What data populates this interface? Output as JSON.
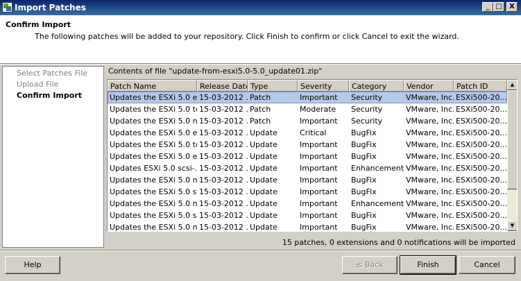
{
  "window": {
    "title": "Import Patches",
    "minimize_glyph": "_",
    "maximize_glyph": "□",
    "close_glyph": "X"
  },
  "header": {
    "title": "Confirm Import",
    "description": "The following patches will be added to your repository. Click Finish to confirm or click Cancel to exit the wizard."
  },
  "steps": [
    {
      "label": "Select Patches File",
      "state": "done"
    },
    {
      "label": "Upload File",
      "state": "done"
    },
    {
      "label": "Confirm Import",
      "state": "current"
    }
  ],
  "file_label": "Contents of file \"update-from-esxi5.0-5.0_update01.zip\"",
  "table": {
    "columns": [
      "Patch Name",
      "Release Date",
      "Type",
      "Severity",
      "Category",
      "Vendor",
      "Patch ID"
    ],
    "rows": [
      [
        "Updates the ESXi 5.0 e...",
        "15-03-2012 ...",
        "Patch",
        "Important",
        "Security",
        "VMware, Inc.",
        "ESXi500-20..."
      ],
      [
        "Updates the ESXi 5.0 to...",
        "15-03-2012 ...",
        "Patch",
        "Moderate",
        "Security",
        "VMware, Inc.",
        "ESXi500-20..."
      ],
      [
        "Updates the ESXi 5.0 n...",
        "15-03-2012 ...",
        "Patch",
        "Important",
        "Security",
        "VMware, Inc.",
        "ESXi500-20..."
      ],
      [
        "Updates the ESXi 5.0 e...",
        "15-03-2012 ...",
        "Update",
        "Critical",
        "BugFix",
        "VMware, Inc.",
        "ESXi500-20..."
      ],
      [
        "Updates the ESXi 5.0 to...",
        "15-03-2012 ...",
        "Update",
        "Important",
        "BugFix",
        "VMware, Inc.",
        "ESXi500-20..."
      ],
      [
        "Updates the ESXi 5.0 e...",
        "15-03-2012 ...",
        "Update",
        "Important",
        "BugFix",
        "VMware, Inc.",
        "ESXi500-20..."
      ],
      [
        "Updates ESXi 5.0 scsi-...",
        "15-03-2012 ...",
        "Update",
        "Important",
        "Enhancement",
        "VMware, Inc.",
        "ESXi500-20..."
      ],
      [
        "Updates the ESXi 5.0 m...",
        "15-03-2012 ...",
        "Update",
        "Important",
        "BugFix",
        "VMware, Inc.",
        "ESXi500-20..."
      ],
      [
        "Updates the ESXi 5.0 s...",
        "15-03-2012 ...",
        "Update",
        "Important",
        "BugFix",
        "VMware, Inc.",
        "ESXi500-20..."
      ],
      [
        "Updates the ESXi 5.0 n...",
        "15-03-2012 ...",
        "Update",
        "Important",
        "Enhancement",
        "VMware, Inc.",
        "ESXi500-20..."
      ],
      [
        "Updates the ESXi 5.0 s...",
        "15-03-2012 ...",
        "Update",
        "Important",
        "BugFix",
        "VMware, Inc.",
        "ESXi500-20..."
      ],
      [
        "Updates the ESXi 5.0 n...",
        "15-03-2012 ...",
        "Update",
        "Important",
        "BugFix",
        "VMware, Inc.",
        "ESXi500-20..."
      ]
    ],
    "selected_row": 0
  },
  "summary": "15 patches, 0 extensions and 0 notifications will be imported",
  "buttons": {
    "help": "Help",
    "back": "≤ Back",
    "finish": "Finish",
    "cancel": "Cancel"
  },
  "colors": {
    "title_bar": "#0a246a",
    "selected_row": "#b5c9e8",
    "dialog_face": "#d4d0c8"
  }
}
